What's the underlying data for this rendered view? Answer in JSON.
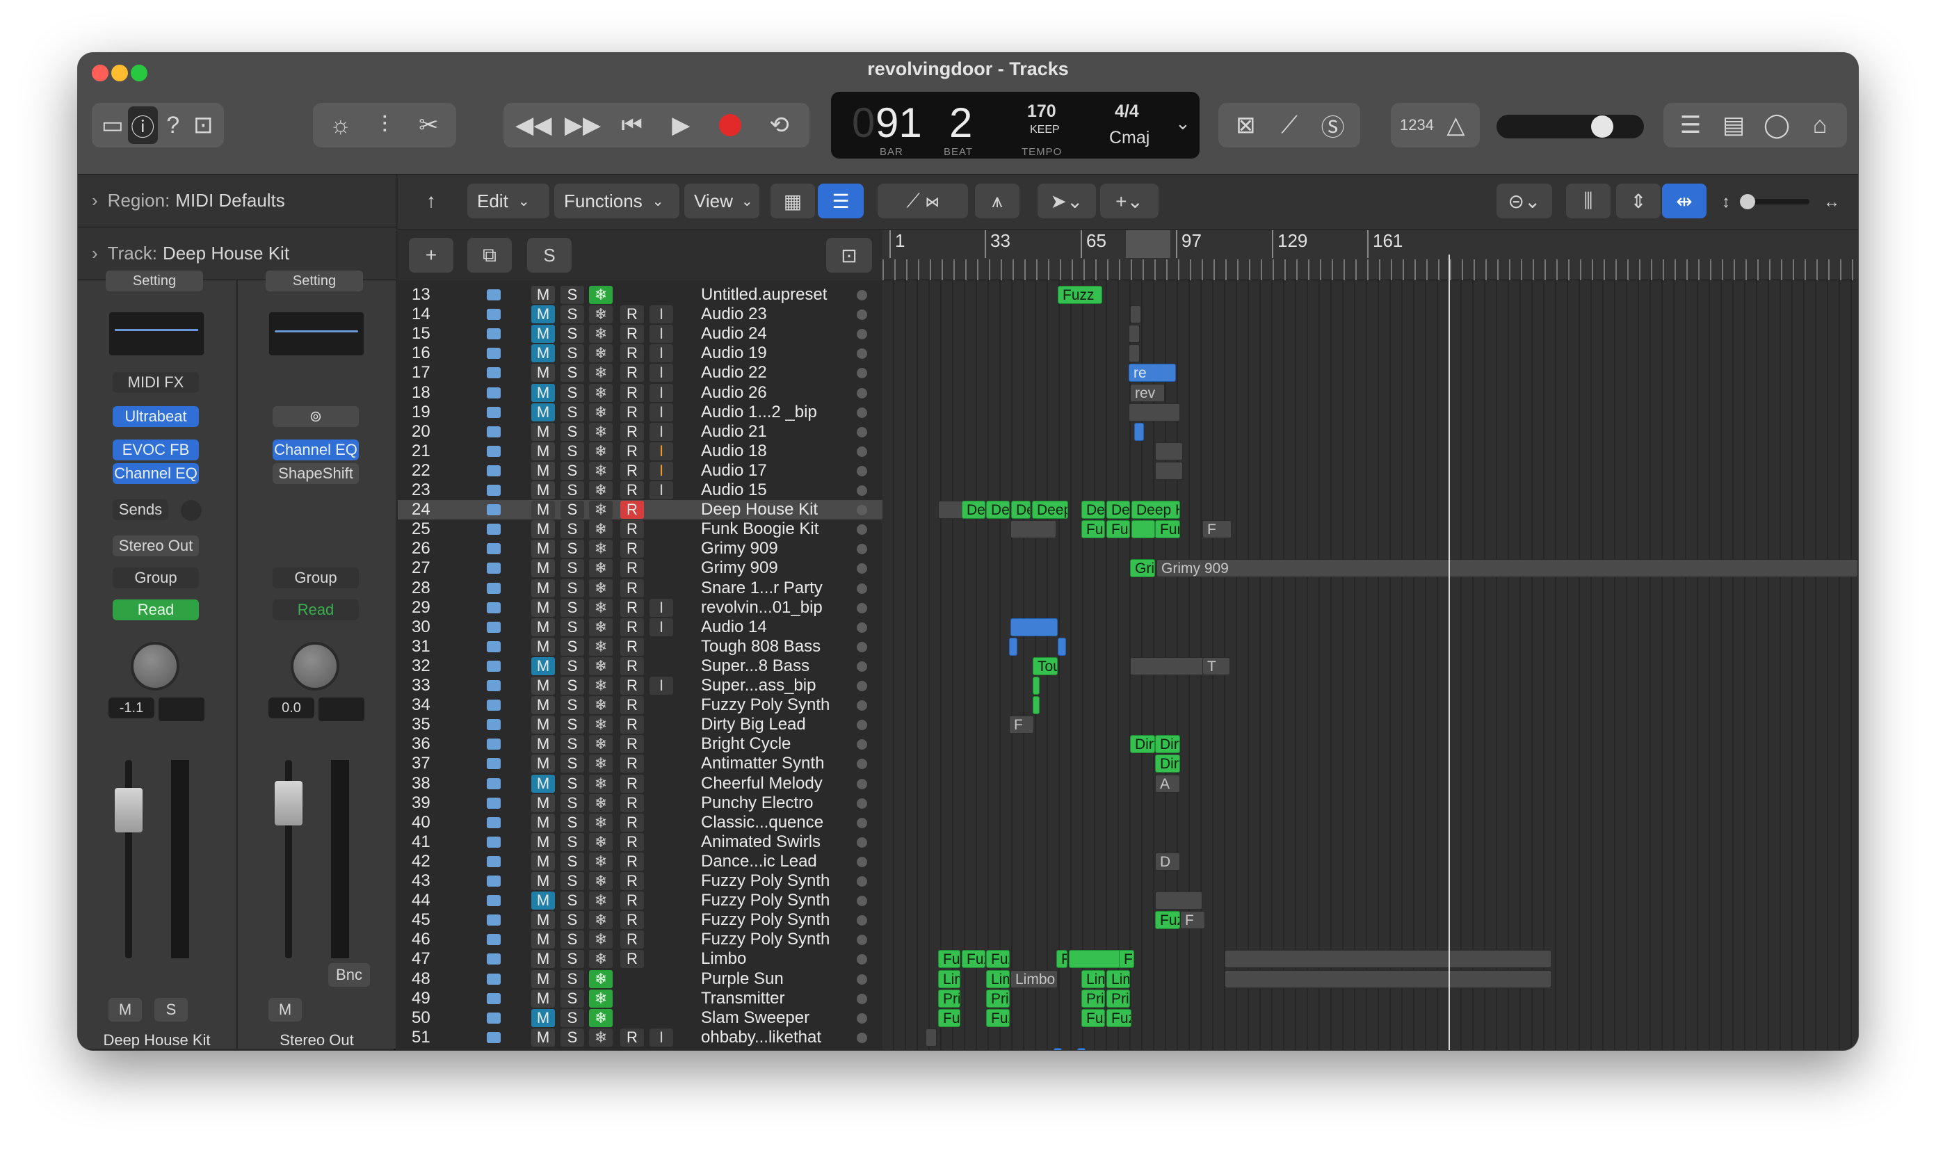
{
  "window": {
    "title": "revolvingdoor - Tracks"
  },
  "lcd": {
    "bar": "91",
    "beat": "2",
    "tempo": "170",
    "tempo_mode": "KEEP",
    "signature": "4/4",
    "key": "Cmaj",
    "bar_label": "BAR",
    "beat_label": "BEAT",
    "tempo_label": "TEMPO"
  },
  "toolbar": {
    "count_in": "1234"
  },
  "inspector": {
    "region_label": "Region:",
    "region_value": "MIDI Defaults",
    "track_label": "Track:",
    "track_value": "Deep House Kit",
    "strip1": {
      "setting": "Setting",
      "midi_fx": "MIDI FX",
      "instrument": "Ultrabeat",
      "fx1": "EVOC FB",
      "fx2": "Channel EQ",
      "sends": "Sends",
      "output": "Stereo Out",
      "group": "Group",
      "automation": "Read",
      "volume": "-1.1",
      "mute": "M",
      "solo": "S",
      "name": "Deep House Kit"
    },
    "strip2": {
      "setting": "Setting",
      "fx1": "Channel EQ",
      "fx2": "ShapeShift",
      "group": "Group",
      "automation": "Read",
      "volume": "0.0",
      "bounce": "Bnc",
      "mute": "M",
      "name": "Stereo Out"
    }
  },
  "track_toolbar": {
    "edit": "Edit",
    "functions": "Functions",
    "view": "View",
    "solo": "S"
  },
  "ruler": {
    "marks": [
      "1",
      "33",
      "65",
      "97",
      "129",
      "161"
    ]
  },
  "tracks": [
    {
      "n": "13",
      "name": "Untitled.aupreset",
      "mute": false,
      "freeze": true,
      "rec": false,
      "input": ""
    },
    {
      "n": "14",
      "name": "Audio 23",
      "mute": true,
      "freeze": false,
      "rec": true,
      "input": "I"
    },
    {
      "n": "15",
      "name": "Audio 24",
      "mute": true,
      "freeze": false,
      "rec": true,
      "input": "I"
    },
    {
      "n": "16",
      "name": "Audio 19",
      "mute": true,
      "freeze": false,
      "rec": true,
      "input": "I"
    },
    {
      "n": "17",
      "name": "Audio 22",
      "mute": false,
      "freeze": false,
      "rec": true,
      "input": "I"
    },
    {
      "n": "18",
      "name": "Audio 26",
      "mute": true,
      "freeze": false,
      "rec": true,
      "input": "I"
    },
    {
      "n": "19",
      "name": "Audio 1...2 _bip",
      "mute": true,
      "freeze": false,
      "rec": true,
      "input": "I"
    },
    {
      "n": "20",
      "name": "Audio 21",
      "mute": false,
      "freeze": false,
      "rec": true,
      "input": "I"
    },
    {
      "n": "21",
      "name": "Audio 18",
      "mute": false,
      "freeze": false,
      "rec": true,
      "input": "I",
      "orange": true
    },
    {
      "n": "22",
      "name": "Audio 17",
      "mute": false,
      "freeze": false,
      "rec": true,
      "input": "I",
      "orange": true
    },
    {
      "n": "23",
      "name": "Audio 15",
      "mute": false,
      "freeze": false,
      "rec": true,
      "input": "I"
    },
    {
      "n": "24",
      "name": "Deep House Kit",
      "mute": false,
      "freeze": false,
      "rec": true,
      "input": "",
      "selected": true,
      "recon": true
    },
    {
      "n": "25",
      "name": "Funk Boogie Kit",
      "mute": false,
      "freeze": false,
      "rec": true,
      "input": ""
    },
    {
      "n": "26",
      "name": "Grimy 909",
      "mute": false,
      "freeze": false,
      "rec": true,
      "input": ""
    },
    {
      "n": "27",
      "name": "Grimy 909",
      "mute": false,
      "freeze": false,
      "rec": true,
      "input": ""
    },
    {
      "n": "28",
      "name": "Snare 1...r Party",
      "mute": false,
      "freeze": false,
      "rec": true,
      "input": ""
    },
    {
      "n": "29",
      "name": "revolvin...01_bip",
      "mute": false,
      "freeze": false,
      "rec": true,
      "input": "I"
    },
    {
      "n": "30",
      "name": "Audio 14",
      "mute": false,
      "freeze": false,
      "rec": true,
      "input": "I"
    },
    {
      "n": "31",
      "name": "Tough 808 Bass",
      "mute": false,
      "freeze": false,
      "rec": true,
      "input": ""
    },
    {
      "n": "32",
      "name": "Super...8 Bass",
      "mute": true,
      "freeze": false,
      "rec": true,
      "input": ""
    },
    {
      "n": "33",
      "name": "Super...ass_bip",
      "mute": false,
      "freeze": false,
      "rec": true,
      "input": "I"
    },
    {
      "n": "34",
      "name": "Fuzzy Poly Synth",
      "mute": false,
      "freeze": false,
      "rec": true,
      "input": ""
    },
    {
      "n": "35",
      "name": "Dirty Big Lead",
      "mute": false,
      "freeze": false,
      "rec": true,
      "input": ""
    },
    {
      "n": "36",
      "name": "Bright Cycle",
      "mute": false,
      "freeze": false,
      "rec": true,
      "input": ""
    },
    {
      "n": "37",
      "name": "Antimatter Synth",
      "mute": false,
      "freeze": false,
      "rec": true,
      "input": ""
    },
    {
      "n": "38",
      "name": "Cheerful Melody",
      "mute": true,
      "freeze": false,
      "rec": true,
      "input": ""
    },
    {
      "n": "39",
      "name": "Punchy Electro",
      "mute": false,
      "freeze": false,
      "rec": true,
      "input": ""
    },
    {
      "n": "40",
      "name": "Classic...quence",
      "mute": false,
      "freeze": false,
      "rec": true,
      "input": ""
    },
    {
      "n": "41",
      "name": "Animated Swirls",
      "mute": false,
      "freeze": false,
      "rec": true,
      "input": ""
    },
    {
      "n": "42",
      "name": "Dance...ic Lead",
      "mute": false,
      "freeze": false,
      "rec": true,
      "input": ""
    },
    {
      "n": "43",
      "name": "Fuzzy Poly Synth",
      "mute": false,
      "freeze": false,
      "rec": true,
      "input": ""
    },
    {
      "n": "44",
      "name": "Fuzzy Poly Synth",
      "mute": true,
      "freeze": false,
      "rec": true,
      "input": ""
    },
    {
      "n": "45",
      "name": "Fuzzy Poly Synth",
      "mute": false,
      "freeze": false,
      "rec": true,
      "input": ""
    },
    {
      "n": "46",
      "name": "Fuzzy Poly Synth",
      "mute": false,
      "freeze": false,
      "rec": true,
      "input": ""
    },
    {
      "n": "47",
      "name": "Limbo",
      "mute": false,
      "freeze": false,
      "rec": true,
      "input": ""
    },
    {
      "n": "48",
      "name": "Purple Sun",
      "mute": false,
      "freeze": true,
      "rec": false,
      "input": ""
    },
    {
      "n": "49",
      "name": "Transmitter",
      "mute": false,
      "freeze": true,
      "rec": false,
      "input": ""
    },
    {
      "n": "50",
      "name": "Slam Sweeper",
      "mute": true,
      "freeze": true,
      "rec": false,
      "input": ""
    },
    {
      "n": "51",
      "name": "ohbaby...likethat",
      "mute": false,
      "freeze": false,
      "rec": true,
      "input": "I"
    }
  ],
  "regions": {
    "r13": "Fuzz",
    "r17": "re",
    "r18": "rev",
    "r24": [
      "Dee",
      "Dee",
      "De",
      "Deep",
      "Dee",
      "Dee",
      "Deep Hou"
    ],
    "r25": [
      "Fun",
      "Fun",
      "Fun",
      "F"
    ],
    "r27": [
      "Gri",
      "Grimy 909"
    ],
    "r31": [
      "Tou",
      "T",
      "T"
    ],
    "r34": "F",
    "r35": [
      "Dirt",
      "Dirt"
    ],
    "r36": "Dirt",
    "r37": "A",
    "r41": "D",
    "r44": [
      "Fuz",
      "F"
    ],
    "r46": [
      "Fuz",
      "Fuzz",
      "Fuz",
      "F",
      "F"
    ],
    "r47": [
      "Lim",
      "Lim",
      "Limbo",
      "Lim",
      "Lim",
      "Li",
      "Li",
      "Li",
      "Li"
    ],
    "r48": [
      "Prim",
      "Prim",
      "Prim",
      "Prim"
    ],
    "r49": [
      "Fuz",
      "Fuz",
      "Fuz",
      "Fuzz"
    ]
  }
}
